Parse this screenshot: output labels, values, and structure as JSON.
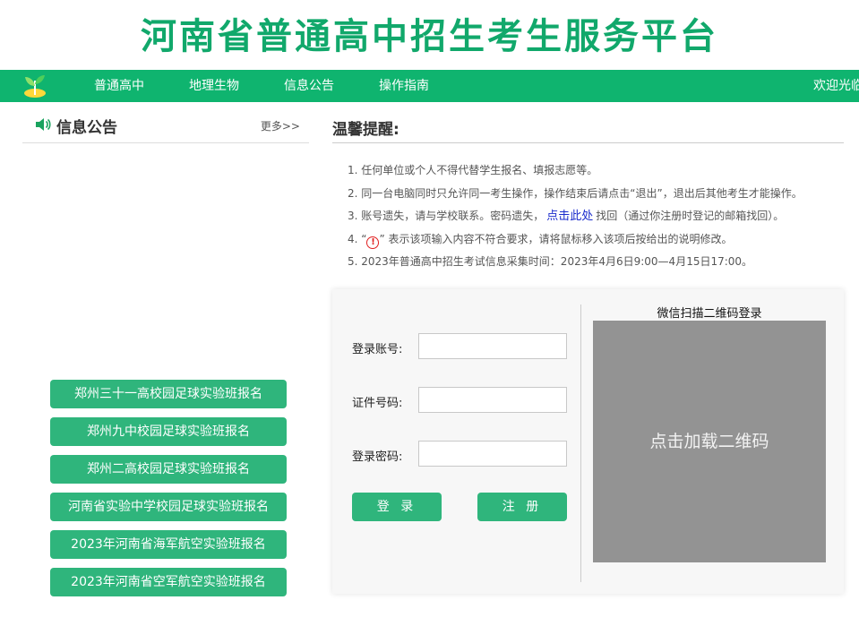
{
  "site": {
    "title": "河南省普通高中招生考生服务平台"
  },
  "nav": {
    "items": [
      "普通高中",
      "地理生物",
      "信息公告",
      "操作指南"
    ],
    "welcome": "欢迎光临"
  },
  "notice": {
    "title": "信息公告",
    "more": "更多>>"
  },
  "enroll_buttons": [
    "郑州三十一高校园足球实验班报名",
    "郑州九中校园足球实验班报名",
    "郑州二高校园足球实验班报名",
    "河南省实验中学校园足球实验班报名",
    "2023年河南省海军航空实验班报名",
    "2023年河南省空军航空实验班报名"
  ],
  "tips": {
    "title": "温馨提醒:",
    "line1": "1. 任何单位或个人不得代替学生报名、填报志愿等。",
    "line2": "2. 同一台电脑同时只允许同一考生操作，操作结束后请点击“退出”，退出后其他考生才能操作。",
    "line3_pre": "3. 账号遗失，请与学校联系。密码遗失，",
    "line3_link": "点击此处",
    "line3_post": "找回（通过你注册时登记的邮箱找回）。",
    "line4_pre": "4. “",
    "line4_icon": "!",
    "line4_post": "” 表示该项输入内容不符合要求，请将鼠标移入该项后按给出的说明修改。",
    "line5": "5. 2023年普通高中招生考试信息采集时间：2023年4月6日9:00—4月15日17:00。"
  },
  "login": {
    "account_label": "登录账号:",
    "id_label": "证件号码:",
    "password_label": "登录密码:",
    "account_value": "",
    "id_value": "",
    "password_value": "",
    "login_button": "登 录",
    "register_button": "注 册"
  },
  "qr": {
    "title": "微信扫描二维码登录",
    "load_text": "点击加载二维码"
  },
  "colors": {
    "brand_green": "#0fb46f",
    "button_green": "#2fb57c",
    "title_green": "#11a86b",
    "link_blue": "#1a2bcc"
  }
}
